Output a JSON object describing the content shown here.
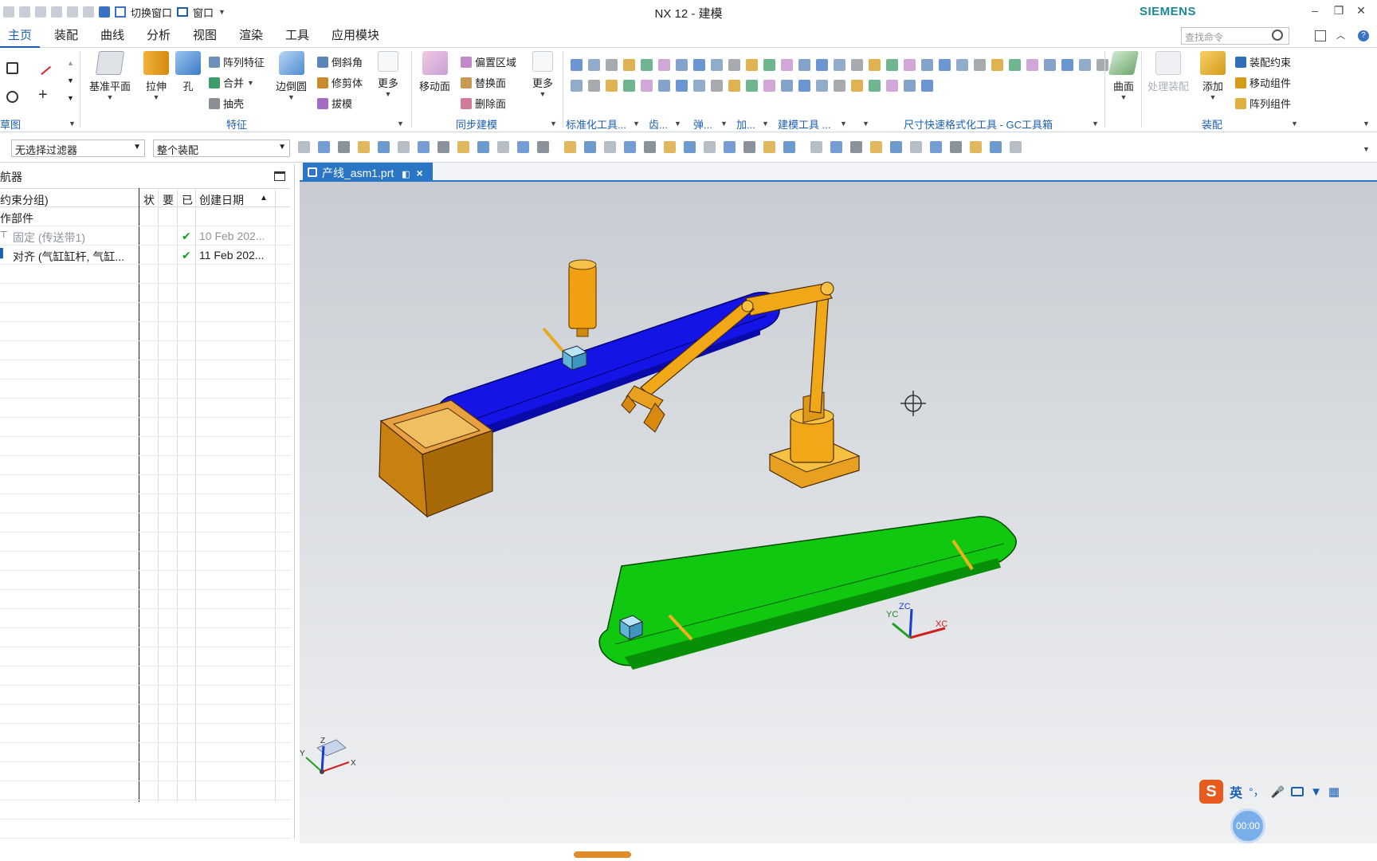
{
  "window": {
    "title": "NX 12 - 建模",
    "brand": "SIEMENS",
    "quick_access": {
      "switch_window": "切换窗口",
      "window_menu": "窗口"
    }
  },
  "menu": {
    "tabs": [
      "主页",
      "装配",
      "曲线",
      "分析",
      "视图",
      "渲染",
      "工具",
      "应用模块"
    ],
    "active": "主页",
    "search_placeholder": "查找命令"
  },
  "ribbon": {
    "sketch_group": "草图",
    "feature_group": "特征",
    "datum_plane": "基准平面",
    "extrude": "拉伸",
    "hole": "孔",
    "pattern_feature": "阵列特征",
    "unite": "合并",
    "shell": "抽壳",
    "edge_blend": "边倒圆",
    "chamfer": "倒斜角",
    "trim_body": "修剪体",
    "draft": "拔模",
    "more1": "更多",
    "sync_group": "同步建模",
    "move_face": "移动面",
    "offset_region": "偏置区域",
    "replace_face": "替换面",
    "delete_face": "删除面",
    "more2": "更多",
    "std_tools": "标准化工具...",
    "gear": "齿...",
    "spring": "弹...",
    "machining": "加...",
    "modeling_tools": "建模工具 ...",
    "dimension_tools": "尺寸快速格式化工具 - GC工具箱",
    "surface": "曲面",
    "surface_group": "曲面",
    "process_assembly": "处理装配",
    "add": "添加",
    "assembly_constraint": "装配约束",
    "move_component": "移动组件",
    "pattern_component": "阵列组件",
    "assembly_group": "装配"
  },
  "selection_bar": {
    "filter": "无选择过滤器",
    "scope": "整个装配"
  },
  "navigator": {
    "title": "航器",
    "columns": [
      "约束分组)",
      "状",
      "要",
      "已",
      "创建日期"
    ],
    "root": "作部件",
    "rows": [
      {
        "name": "固定 (传送带1)",
        "checked": true,
        "date": "10 Feb 202...",
        "muted": true
      },
      {
        "name": "对齐 (气缸缸杆, 气缸...",
        "checked": true,
        "date": "11 Feb 202...",
        "muted": false
      }
    ],
    "check_glyph": "✔"
  },
  "graphics": {
    "doc_tab": "产线_asm1.prt",
    "close_glyph": "×",
    "wcs_labels": {
      "zc": "ZC",
      "yc": "YC",
      "xc": "XC"
    },
    "triad_labels": {
      "z": "Z",
      "y": "Y",
      "x": "X"
    }
  },
  "ime": {
    "lang": "英",
    "punct": "°，",
    "timer": "00:00"
  },
  "colors": {
    "accent": "#1b5fb1",
    "conveyor_blue": "#1010e6",
    "conveyor_green": "#0cc40c",
    "robot_orange": "#f0a010",
    "box_brown": "#c88010"
  }
}
